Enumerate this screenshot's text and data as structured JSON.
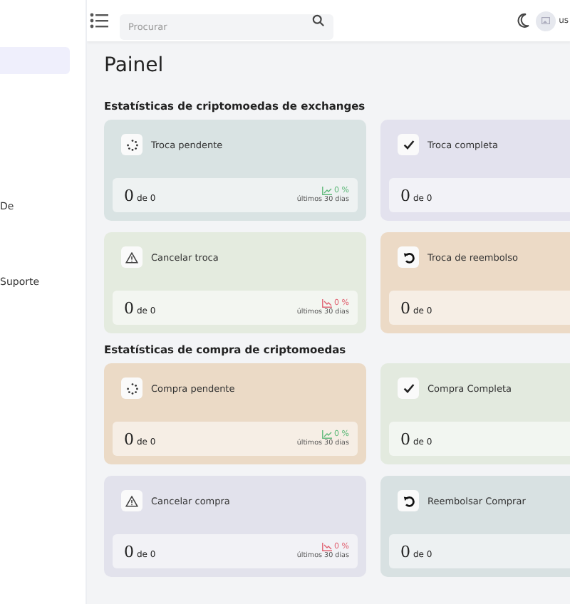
{
  "header": {
    "search": {
      "placeholder": "Procurar"
    },
    "user": "us"
  },
  "sidebar": {
    "items": [
      {
        "selected": true
      },
      {
        "label": "De",
        "selected": false
      },
      {
        "label": "Suporte",
        "selected": false
      }
    ]
  },
  "page_title": "Painel",
  "sections": [
    {
      "title": "Estatísticas de criptomoedas de exchanges",
      "cards": [
        {
          "kind": "pending",
          "title": "Troca pendente",
          "color": "#d9e3e3",
          "value": "0",
          "of": "de 0",
          "trend": {
            "kind": "up",
            "percent": "0 %",
            "period": "últimos 30 dias"
          }
        },
        {
          "kind": "complete",
          "title": "Troca completa",
          "color": "#e3e2ee",
          "value": "0",
          "of": "de 0"
        },
        {
          "kind": "cancel",
          "title": "Cancelar troca",
          "color": "#e4ebdf",
          "value": "0",
          "of": "de 0",
          "trend": {
            "kind": "down",
            "percent": "0 %",
            "period": "últimos 30 dias"
          }
        },
        {
          "kind": "refund",
          "title": "Troca de reembolso",
          "color": "#ecdac6",
          "value": "0",
          "of": "de 0"
        }
      ]
    },
    {
      "title": "Estatísticas de compra de criptomoedas",
      "cards": [
        {
          "kind": "pending",
          "title": "Compra pendente",
          "color": "#ebdac6",
          "value": "0",
          "of": "de 0",
          "trend": {
            "kind": "up",
            "percent": "0 %",
            "period": "últimos 30 dias"
          }
        },
        {
          "kind": "complete",
          "title": "Compra Completa",
          "color": "#e3eadf",
          "value": "0",
          "of": "de 0"
        },
        {
          "kind": "cancel",
          "title": "Cancelar compra",
          "color": "#e2e2ec",
          "value": "0",
          "of": "de 0",
          "trend": {
            "kind": "down",
            "percent": "0 %",
            "period": "últimos 30 dias"
          }
        },
        {
          "kind": "refund",
          "title": "Reembolsar Comprar",
          "color": "#d8e1e2",
          "value": "0",
          "of": "de 0"
        }
      ]
    }
  ]
}
